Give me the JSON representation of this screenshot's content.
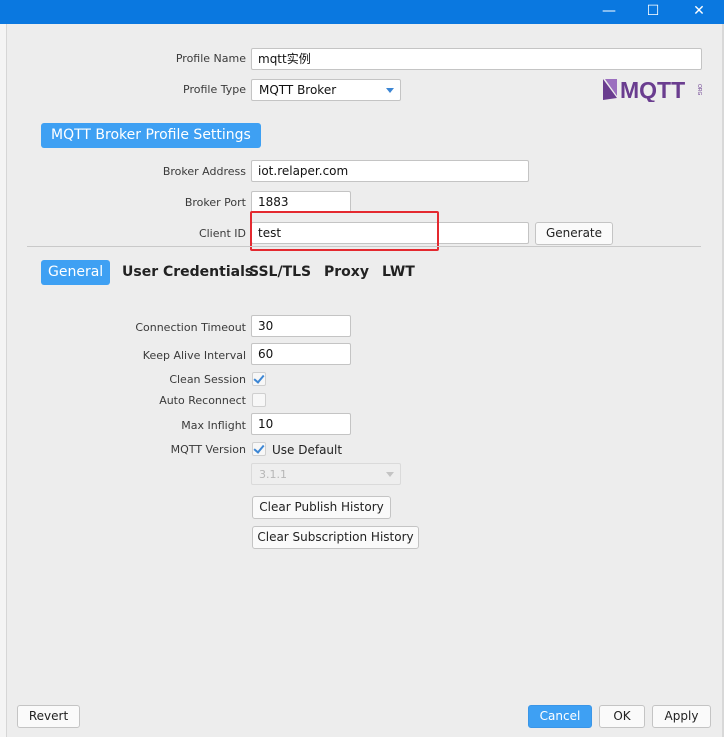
{
  "titlebar": {
    "minimize_glyph": "—",
    "maximize_glyph": "☐",
    "close_glyph": "✕"
  },
  "profile": {
    "name_label": "Profile Name",
    "name_value": "mqtt实例",
    "type_label": "Profile Type",
    "type_value": "MQTT Broker",
    "logo_text": "MQTT",
    "logo_small": "ORG"
  },
  "broker": {
    "section_title": "MQTT Broker Profile Settings",
    "address_label": "Broker Address",
    "address_value": "iot.relaper.com",
    "port_label": "Broker Port",
    "port_value": "1883",
    "client_id_label": "Client ID",
    "client_id_value": "test",
    "generate_label": "Generate"
  },
  "tabs": [
    {
      "label": "General",
      "active": true
    },
    {
      "label": "User Credentials"
    },
    {
      "label": "SSL/TLS"
    },
    {
      "label": "Proxy"
    },
    {
      "label": "LWT"
    }
  ],
  "general": {
    "conn_timeout_label": "Connection Timeout",
    "conn_timeout_value": "30",
    "keep_alive_label": "Keep Alive Interval",
    "keep_alive_value": "60",
    "clean_session_label": "Clean Session",
    "clean_session_checked": true,
    "auto_reconnect_label": "Auto Reconnect",
    "auto_reconnect_checked": false,
    "max_inflight_label": "Max Inflight",
    "max_inflight_value": "10",
    "mqtt_version_label": "MQTT Version",
    "use_default_label": "Use Default",
    "use_default_checked": true,
    "version_value": "3.1.1",
    "clear_publish_label": "Clear Publish History",
    "clear_subscription_label": "Clear Subscription History"
  },
  "footer": {
    "revert": "Revert",
    "cancel": "Cancel",
    "ok": "OK",
    "apply": "Apply"
  },
  "colors": {
    "accent": "#3ea0f3",
    "titlebar": "#0a78e0",
    "highlight": "#e4292f",
    "logo": "#6a3d8f"
  }
}
